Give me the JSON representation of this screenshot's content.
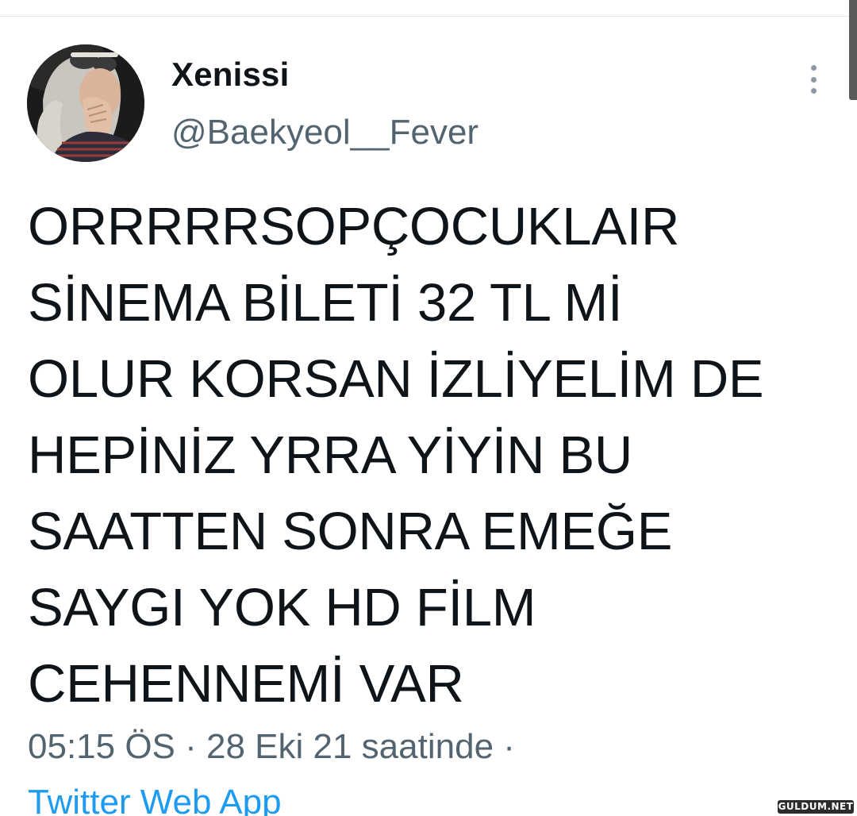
{
  "user": {
    "display_name": "Xenissi",
    "handle": "@Baekyeol__Fever"
  },
  "tweet": {
    "text": "ORRRRRSOPÇOCUKLAIR\nSİNEMA BİLETİ 32 TL Mİ\nOLUR KORSAN İZLİYELİM DE\nHEPİNİZ YRRA YİYİN BU\nSAATTEN SONRA EMEĞE\nSAYGI YOK HD FİLM\nCEHENNEMİ VAR"
  },
  "meta": {
    "timestamp": "05:15 ÖS · 28 Eki 21 saatinde ·",
    "source": "Twitter Web App"
  },
  "watermark": "GULDUM.NET",
  "colors": {
    "text_primary": "#0f1419",
    "text_secondary": "#536471",
    "link": "#1d9bf0",
    "divider": "#e3e6e8"
  },
  "icons": {
    "more": "more-vertical-icon"
  }
}
